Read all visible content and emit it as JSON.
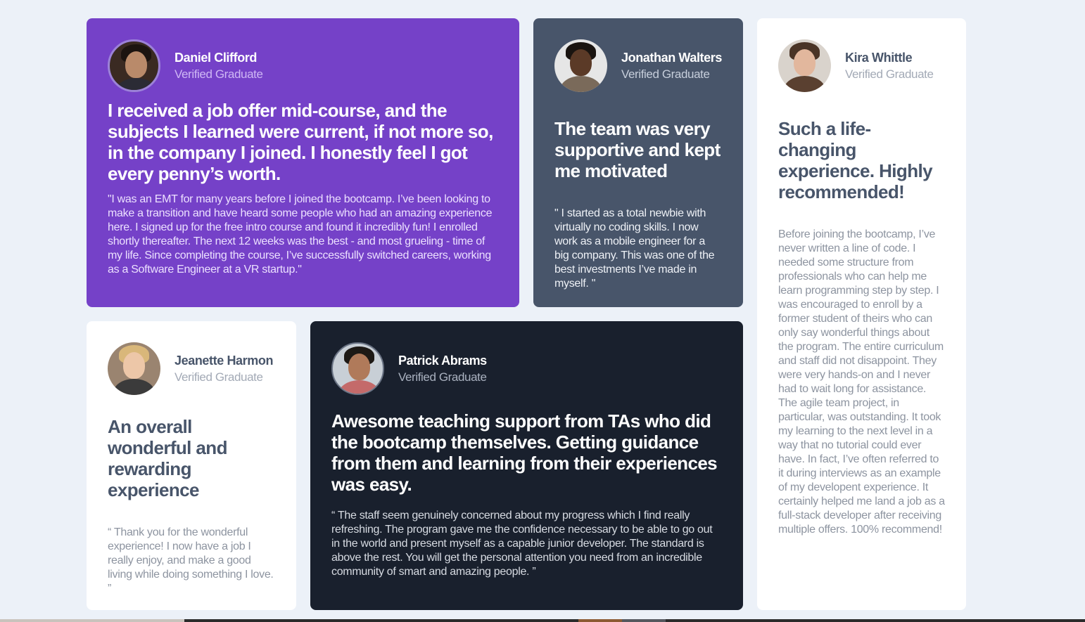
{
  "testimonials": {
    "daniel": {
      "name": "Daniel Clifford",
      "role": "Verified Graduate",
      "headline": "I received a job offer mid-course, and the subjects I learned were current, if not more so, in the company I joined. I honestly feel I got every penny’s worth.",
      "quote": "\"I was an EMT for many years before I joined the bootcamp. I’ve been looking to make a transition and have heard some people who had an amazing experience here. I signed up for the free intro course and found it incredibly fun! I enrolled shortly thereafter. The next 12 weeks was the best - and most grueling - time of my life. Since completing the course, I’ve successfully switched careers, working as a Software Engineer at a VR startup.\""
    },
    "jonathan": {
      "name": "Jonathan Walters",
      "role": "Verified Graduate",
      "headline": "The team was very supportive and kept me motivated",
      "quote": "\" I started as a total newbie with virtually no coding skills. I now work as a mobile engineer for a big company. This was one of the best investments I’ve made in myself. \""
    },
    "kira": {
      "name": "Kira Whittle",
      "role": "Verified Graduate",
      "headline": "Such a life-changing experience. Highly recommended!",
      "quote": "Before joining the bootcamp, I’ve never written a line of code. I needed some structure from professionals who can help me learn programming step by step. I was encouraged to enroll by a former student of theirs who can only say wonderful things about the program. The entire curriculum and staff did not disappoint. They were very hands-on and I never had to wait long for assistance. The agile team project, in particular, was outstanding. It took my learning to the next level in a way that no tutorial could ever have. In fact, I’ve often referred to it during interviews as an example of my developent experience. It certainly helped me land a job as a full-stack developer after receiving multiple offers. 100% recommend!"
    },
    "jeanette": {
      "name": "Jeanette Harmon",
      "role": "Verified Graduate",
      "headline": "An overall wonderful and rewarding experience",
      "quote": "“ Thank you for the wonderful experience! I now have a job I really enjoy, and make a good living while doing something I love. ”"
    },
    "patrick": {
      "name": "Patrick Abrams",
      "role": "Verified Graduate",
      "headline": "Awesome teaching support from TAs who did the bootcamp themselves. Getting guidance from them and learning from their experiences was easy.",
      "quote": "“ The staff seem genuinely concerned about my progress which I find really refreshing. The program gave me the confidence necessary to be able to go out in the world and present myself as a capable junior developer. The standard is above the rest. You will get the personal attention you need from an incredible community of smart and amazing people. ”"
    }
  },
  "colors": {
    "background": "#ecf1f8",
    "purple": "#7541c8",
    "grey_blue": "#48556a",
    "dark": "#19202d",
    "white": "#ffffff"
  },
  "icons": {
    "avatar": "person-photo"
  }
}
